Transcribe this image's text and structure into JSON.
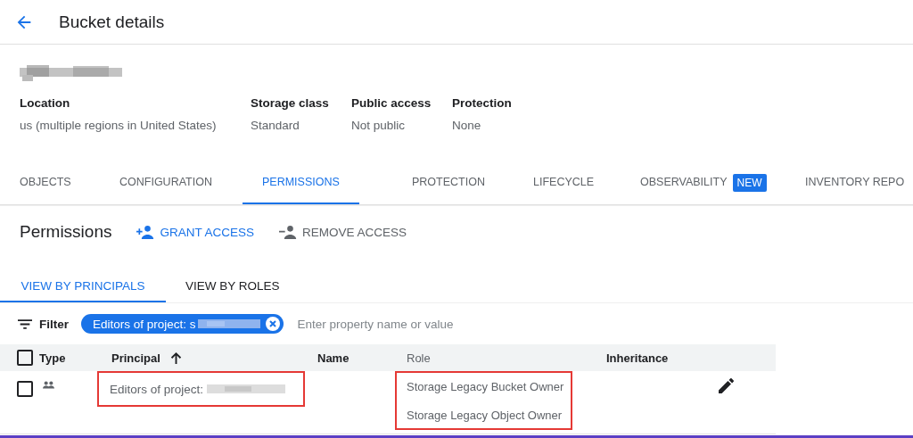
{
  "header": {
    "title": "Bucket details"
  },
  "properties": [
    {
      "label": "Location",
      "value": "us (multiple regions in United States)"
    },
    {
      "label": "Storage class",
      "value": "Standard"
    },
    {
      "label": "Public access",
      "value": "Not public"
    },
    {
      "label": "Protection",
      "value": "None"
    }
  ],
  "tabs": [
    {
      "label": "OBJECTS",
      "selected": false
    },
    {
      "label": "CONFIGURATION",
      "selected": false
    },
    {
      "label": "PERMISSIONS",
      "selected": true
    },
    {
      "label": "PROTECTION",
      "selected": false
    },
    {
      "label": "LIFECYCLE",
      "selected": false
    },
    {
      "label": "OBSERVABILITY",
      "selected": false,
      "badge": "NEW"
    },
    {
      "label": "INVENTORY REPO",
      "selected": false
    }
  ],
  "permissions": {
    "title": "Permissions",
    "actions": [
      {
        "kind": "grant",
        "label": "GRANT ACCESS",
        "disabled": false
      },
      {
        "kind": "remove",
        "label": "REMOVE ACCESS",
        "disabled": true
      }
    ]
  },
  "view_tabs": [
    {
      "label": "VIEW BY PRINCIPALS",
      "selected": true
    },
    {
      "label": "VIEW BY ROLES",
      "selected": false
    }
  ],
  "filter": {
    "label": "Filter",
    "chip": "Editors of project: s",
    "placeholder": "Enter property name or value"
  },
  "table": {
    "all_checked": false,
    "columns": [
      {
        "label": "Type",
        "sorted": false
      },
      {
        "label": "Principal",
        "sorted": true
      },
      {
        "label": "Name",
        "sorted": false
      },
      {
        "label": "Role",
        "sorted": false
      },
      {
        "label": "Inheritance",
        "sorted": false
      }
    ],
    "rows": [
      {
        "checked": false,
        "kind": "group",
        "principal": "Editors of project:",
        "principal_highlighted": true,
        "roles": [
          "Storage Legacy Bucket Owner",
          "Storage Legacy Object Owner"
        ],
        "roles_highlighted": true
      }
    ]
  }
}
